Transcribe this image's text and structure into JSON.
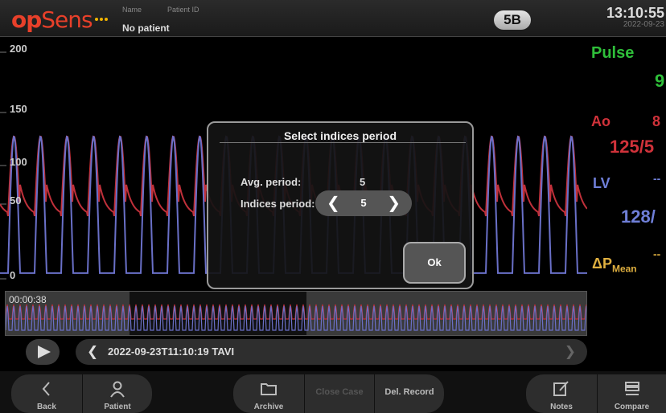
{
  "header": {
    "logo_op": "op",
    "logo_sens": "Sens",
    "name_label": "Name",
    "patient_id_label": "Patient ID",
    "patient_name": "No patient",
    "mode_badge": "5B",
    "time": "13:10:55",
    "date": "2022-09-23"
  },
  "plot": {
    "y_ticks": [
      "200",
      "150",
      "100",
      "50",
      "0"
    ],
    "y_range": [
      0,
      200
    ],
    "ao_color": "#c0303a",
    "lv_color": "#6a70c8"
  },
  "right_panel": {
    "pulse_label": "Pulse",
    "pulse_value": "9",
    "pulse_color": "#2fbf3a",
    "ao_label": "Ao",
    "ao_mean": "8",
    "ao_value": "125/5",
    "ao_color": "#d0323a",
    "lv_label": "LV",
    "lv_dash": "--",
    "lv_value": "128/",
    "lv_color": "#6f7fd8",
    "dp_symbol": "ΔP",
    "dp_subscript": "Mean",
    "dp_dash": "--",
    "dp_color": "#e0b040"
  },
  "overview": {
    "time": "00:00:38"
  },
  "record_bar": {
    "text": "2022-09-23T11:10:19   TAVI"
  },
  "toolbar": {
    "back": "Back",
    "patient": "Patient",
    "archive": "Archive",
    "close_case": "Close Case",
    "del_record": "Del. Record",
    "notes": "Notes",
    "compare": "Compare"
  },
  "dialog": {
    "title": "Select indices period",
    "avg_label": "Avg. period:",
    "avg_value": "5",
    "indices_label": "Indices period:",
    "indices_value": "5",
    "ok": "Ok"
  }
}
